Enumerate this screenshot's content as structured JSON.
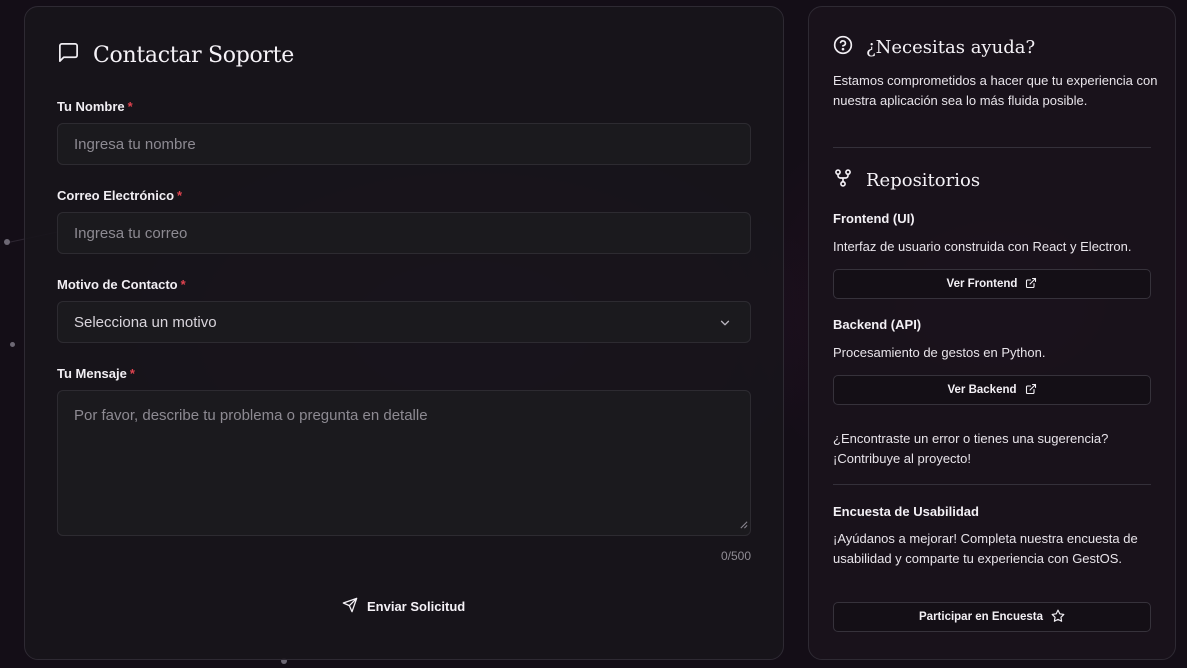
{
  "form": {
    "title": "Contactar Soporte",
    "name_label": "Tu Nombre",
    "name_placeholder": "Ingresa tu nombre",
    "email_label": "Correo Electrónico",
    "email_placeholder": "Ingresa tu correo",
    "reason_label": "Motivo de Contacto",
    "reason_selected": "Selecciona un motivo",
    "message_label": "Tu Mensaje",
    "message_placeholder": "Por favor, describe tu problema o pregunta en detalle",
    "required_mark": "*",
    "counter": "0/500",
    "submit_label": "Enviar Solicitud"
  },
  "help": {
    "title": "¿Necesitas ayuda?",
    "description": "Estamos comprometidos a hacer que tu experiencia con nuestra aplicación sea lo más fluida posible."
  },
  "repos": {
    "title": "Repositorios",
    "frontend_title": "Frontend (UI)",
    "frontend_desc": "Interfaz de usuario construida con React y Electron.",
    "frontend_button": "Ver Frontend",
    "backend_title": "Backend (API)",
    "backend_desc": "Procesamiento de gestos en Python.",
    "backend_button": "Ver Backend",
    "contribute_line1": "¿Encontraste un error o tienes una sugerencia?",
    "contribute_line2": "¡Contribuye al proyecto!"
  },
  "survey": {
    "title": "Encuesta de Usabilidad",
    "description": "¡Ayúdanos a mejorar! Completa nuestra encuesta de usabilidad y comparte tu experiencia con GestOS.",
    "button": "Participar en Encuesta"
  },
  "icons": {
    "form_title": "message-square-icon",
    "select": "chevron-down-icon",
    "submit": "send-icon",
    "help": "help-circle-icon",
    "repos": "git-fork-icon",
    "external": "external-link-icon",
    "survey": "star-icon"
  },
  "colors": {
    "required": "#e0434f",
    "background": "#140e17",
    "panel": "#18151b",
    "field": "#1b1a1e"
  }
}
